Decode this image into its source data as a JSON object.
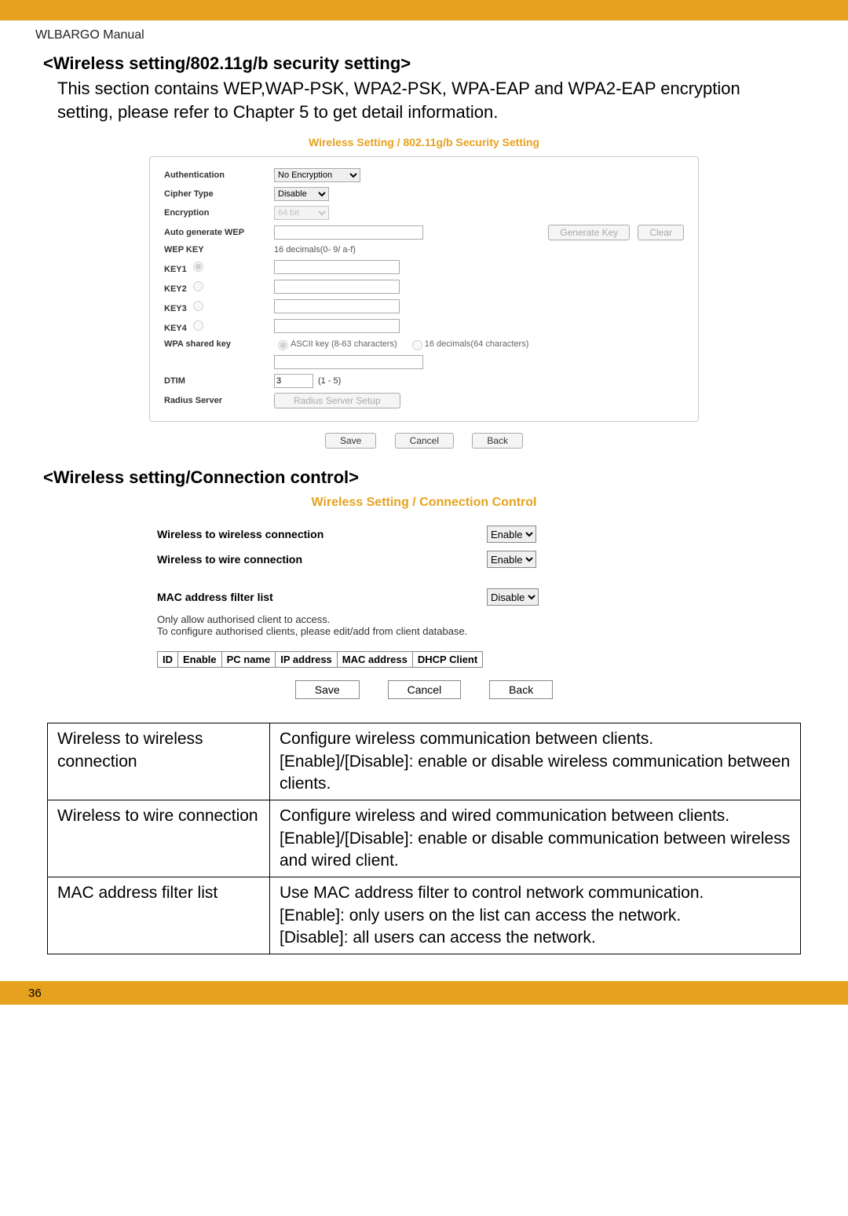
{
  "manual_label": "WLBARGO Manual",
  "section1": {
    "header": "<Wireless setting/802.11g/b security setting>",
    "intro": "This section contains WEP,WAP-PSK, WPA2-PSK, WPA-EAP and WPA2-EAP encryption setting, please refer to Chapter 5 to get detail information."
  },
  "shot1": {
    "title": "Wireless Setting / 802.11g/b Security Setting",
    "labels": {
      "authentication": "Authentication",
      "cipher": "Cipher Type",
      "encryption": "Encryption",
      "autogen": "Auto generate WEP",
      "wepkey": "WEP KEY",
      "key1": "KEY1",
      "key2": "KEY2",
      "key3": "KEY3",
      "key4": "KEY4",
      "wpa": "WPA shared key",
      "dtim": "DTIM",
      "radius": "Radius Server"
    },
    "values": {
      "authentication": "No Encryption",
      "cipher": "Disable",
      "encryption": "64 bit",
      "wepkey_note": "16 decimals(0- 9/ a-f)",
      "wpa_radio1": "ASCII key (8-63 characters)",
      "wpa_radio2": "16 decimals(64 characters)",
      "dtim_value": "3",
      "dtim_range": "(1 - 5)",
      "radius_btn": "Radius Server Setup"
    },
    "buttons": {
      "genkey": "Generate Key",
      "clear": "Clear",
      "save": "Save",
      "cancel": "Cancel",
      "back": "Back"
    }
  },
  "section2_header": "<Wireless setting/Connection control>",
  "shot2": {
    "title": "Wireless Setting / Connection Control",
    "labels": {
      "w2w": "Wireless to wireless connection",
      "w2wire": "Wireless to wire connection",
      "macfilter": "MAC address filter list"
    },
    "values": {
      "w2w": "Enable",
      "w2wire": "Enable",
      "macfilter": "Disable"
    },
    "note_line1": "Only allow authorised client to access.",
    "note_line2": "To configure authorised clients, please edit/add from client database.",
    "table_headers": [
      "ID",
      "Enable",
      "PC name",
      "IP address",
      "MAC address",
      "DHCP Client"
    ],
    "buttons": {
      "save": "Save",
      "cancel": "Cancel",
      "back": "Back"
    }
  },
  "desc_table": {
    "rows": [
      {
        "label": "Wireless to wireless connection",
        "desc": "Configure wireless communication between clients. [Enable]/[Disable]: enable or disable wireless communication between clients."
      },
      {
        "label": "Wireless to wire connection",
        "desc": "Configure wireless and wired communication between clients.\n[Enable]/[Disable]: enable or disable communication between wireless and wired client."
      },
      {
        "label": "MAC address filter list",
        "desc": "Use MAC address filter to control network communication.\n[Enable]: only users on the list can access the network.\n[Disable]: all users can access the network."
      }
    ]
  },
  "page_number": "36"
}
